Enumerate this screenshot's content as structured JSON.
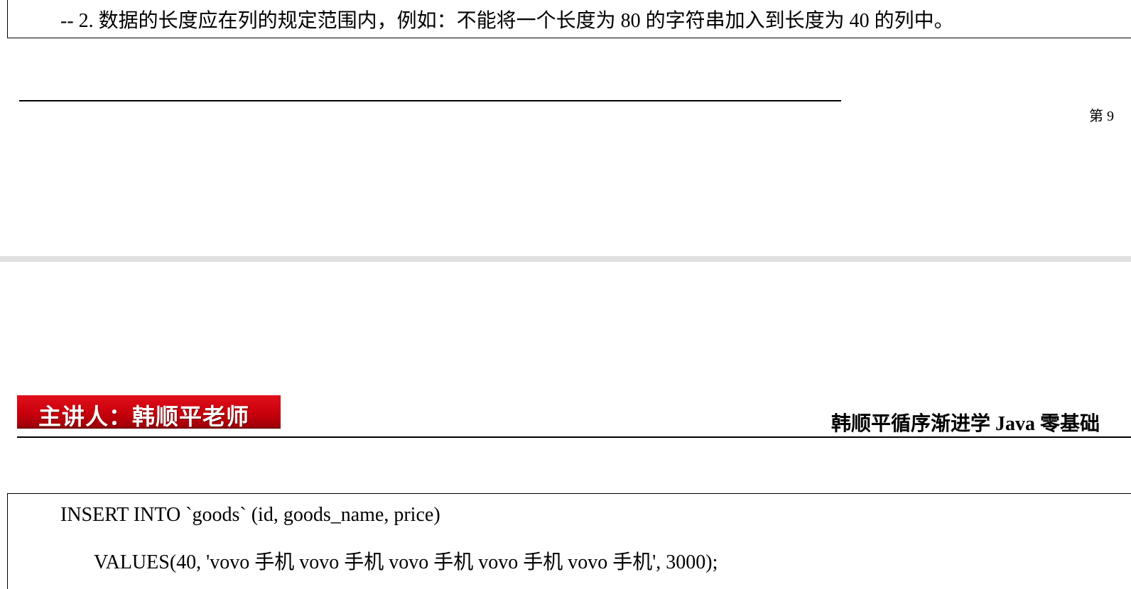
{
  "top_page": {
    "note_line": "-- 2. 数据的长度应在列的规定范围内，例如：不能将一个长度为 80 的字符串加入到长度为 40 的列中。",
    "page_number": "第 9"
  },
  "bottom_page": {
    "lecturer_banner": "主讲人：韩顺平老师",
    "header_title": "韩顺平循序渐进学 Java 零基础",
    "code_lines": [
      "INSERT INTO `goods` (id, goods_name, price)",
      "VALUES(40, 'vovo 手机 vovo 手机 vovo 手机 vovo 手机 vovo 手机', 3000);"
    ]
  }
}
